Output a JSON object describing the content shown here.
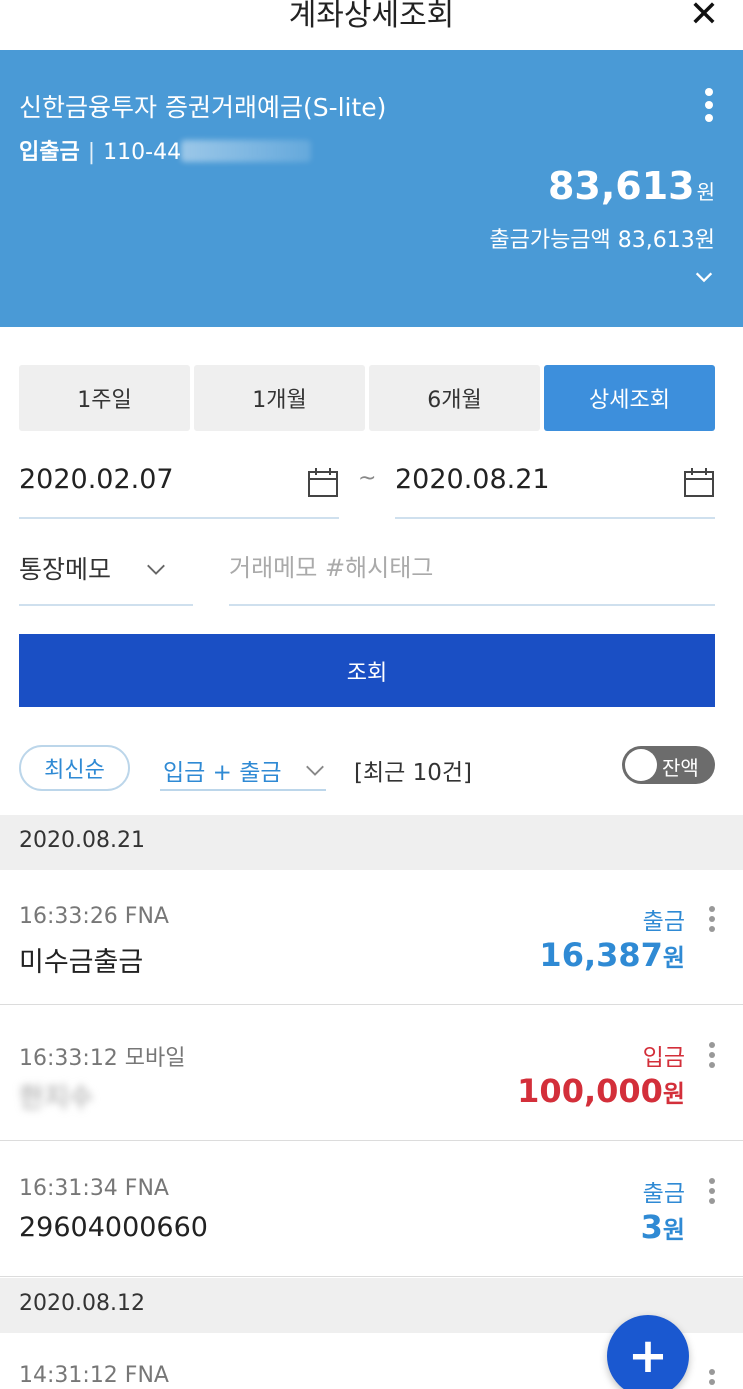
{
  "header": {
    "title": "계좌상세조회"
  },
  "account": {
    "name": "신한금융투자 증권거래예금(S-lite)",
    "type_label": "입출금",
    "number_visible": "110-44",
    "balance": "83,613",
    "balance_unit": "원",
    "available": "출금가능금액 83,613원"
  },
  "periods": [
    "1주일",
    "1개월",
    "6개월",
    "상세조회"
  ],
  "date_range": {
    "from": "2020.02.07",
    "to": "2020.08.21",
    "separator": "~"
  },
  "memo": {
    "select_value": "통장메모",
    "input_placeholder": "거래메모 #해시태그"
  },
  "search_button": "조회",
  "filters": {
    "sort": "최신순",
    "type": "입금 + 출금",
    "count": "[최근 10건]",
    "balance_toggle": "잔액"
  },
  "groups": [
    {
      "date": "2020.08.21",
      "items": [
        {
          "time": "16:33:26 FNA",
          "desc": "미수금출금",
          "kind": "출금",
          "amount": "16,387",
          "unit": "원"
        },
        {
          "time": "16:33:12 모바일",
          "desc": "한지수",
          "kind": "입금",
          "amount": "100,000",
          "unit": "원"
        },
        {
          "time": "16:31:34 FNA",
          "desc": "29604000660",
          "kind": "출금",
          "amount": "3",
          "unit": "원"
        }
      ]
    },
    {
      "date": "2020.08.12",
      "items": [
        {
          "time": "14:31:12 FNA"
        }
      ]
    }
  ],
  "fab": "+",
  "colors": {
    "account_bg": "#4a9ad6",
    "primary": "#1a4fc4",
    "withdraw": "#2f8ad4",
    "deposit": "#d32f3a"
  }
}
